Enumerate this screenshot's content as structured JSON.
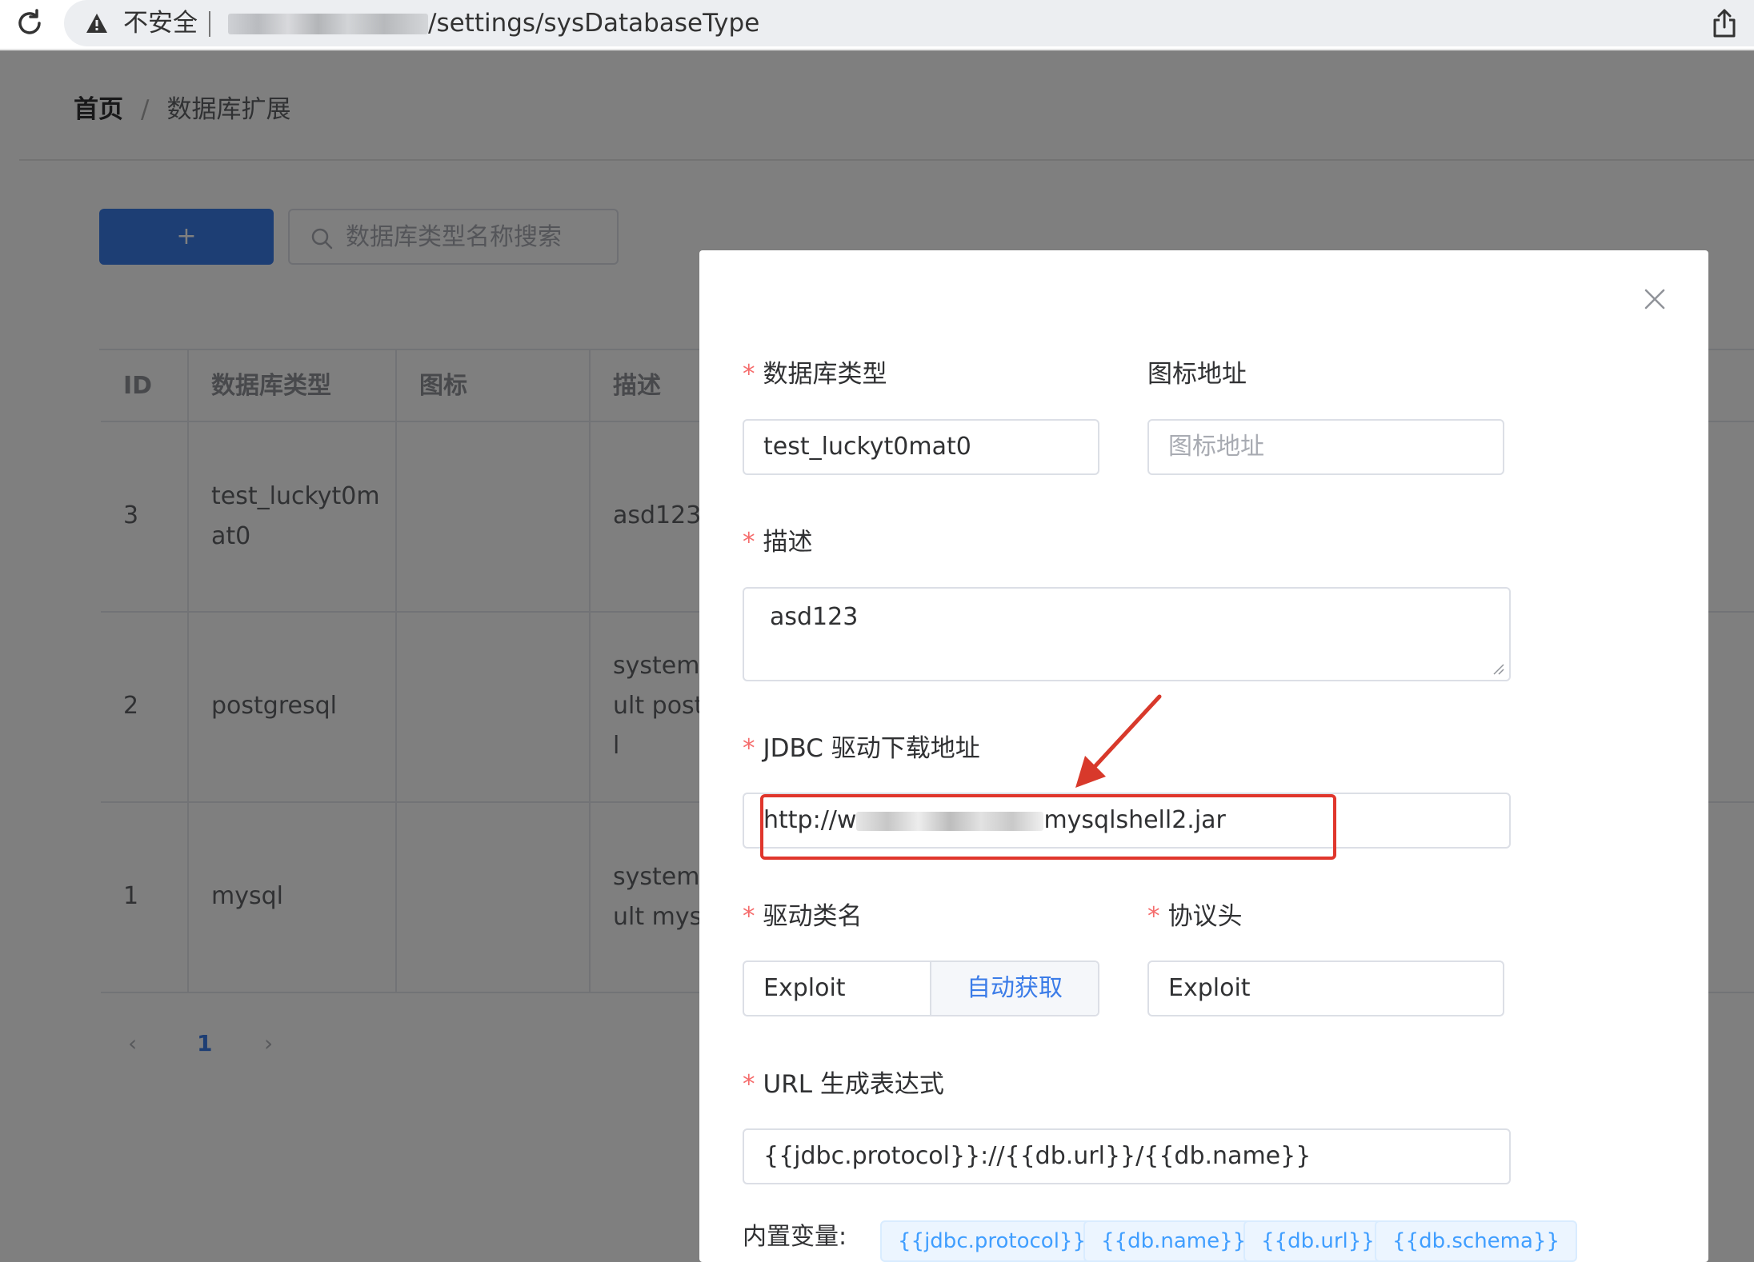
{
  "browser": {
    "security_label": "不安全",
    "url_path": "/settings/sysDatabaseType"
  },
  "breadcrumb": {
    "home": "首页",
    "separator": "/",
    "current": "数据库扩展"
  },
  "toolbar": {
    "add_label": "+",
    "search_placeholder": "数据库类型名称搜索"
  },
  "table": {
    "columns": [
      "ID",
      "数据库类型",
      "图标",
      "描述"
    ],
    "rows": [
      {
        "id": "3",
        "type_line1": "test_luckyt0m",
        "type_line2": "at0",
        "desc_line1": "asd123",
        "desc_line2": "",
        "desc_line3": ""
      },
      {
        "id": "2",
        "type_line1": "postgresql",
        "type_line2": "",
        "desc_line1": "system",
        "desc_line2": "ult post",
        "desc_line3": "l"
      },
      {
        "id": "1",
        "type_line1": "mysql",
        "type_line2": "",
        "desc_line1": "system",
        "desc_line2": "ult mysc",
        "desc_line3": ""
      }
    ]
  },
  "pagination": {
    "prev": "‹",
    "current": "1",
    "next": "›"
  },
  "dialog": {
    "close": "×",
    "required_mark": "*",
    "db_type": {
      "label": "数据库类型",
      "value": "test_luckyt0mat0"
    },
    "icon_url": {
      "label": "图标地址",
      "placeholder": "图标地址"
    },
    "description": {
      "label": "描述",
      "value": "asd123"
    },
    "jdbc_url": {
      "label": "JDBC 驱动下载地址",
      "value_prefix": "http://w",
      "value_suffix": "mysqlshell2.jar"
    },
    "driver_class": {
      "label": "驱动类名",
      "value": "Exploit",
      "auto_button": "自动获取"
    },
    "protocol": {
      "label": "协议头",
      "value": "Exploit"
    },
    "url_expr": {
      "label": "URL 生成表达式",
      "value": "{{jdbc.protocol}}://{{db.url}}/{{db.name}}"
    },
    "builtin_vars": {
      "label": "内置变量:",
      "tags": [
        "{{jdbc.protocol}}",
        "{{db.name}}",
        "{{db.url}}",
        "{{db.schema}}"
      ]
    }
  },
  "colors": {
    "primary": "#3b7ce8",
    "danger_highlight": "#e0362c",
    "required": "#f56c6c"
  }
}
